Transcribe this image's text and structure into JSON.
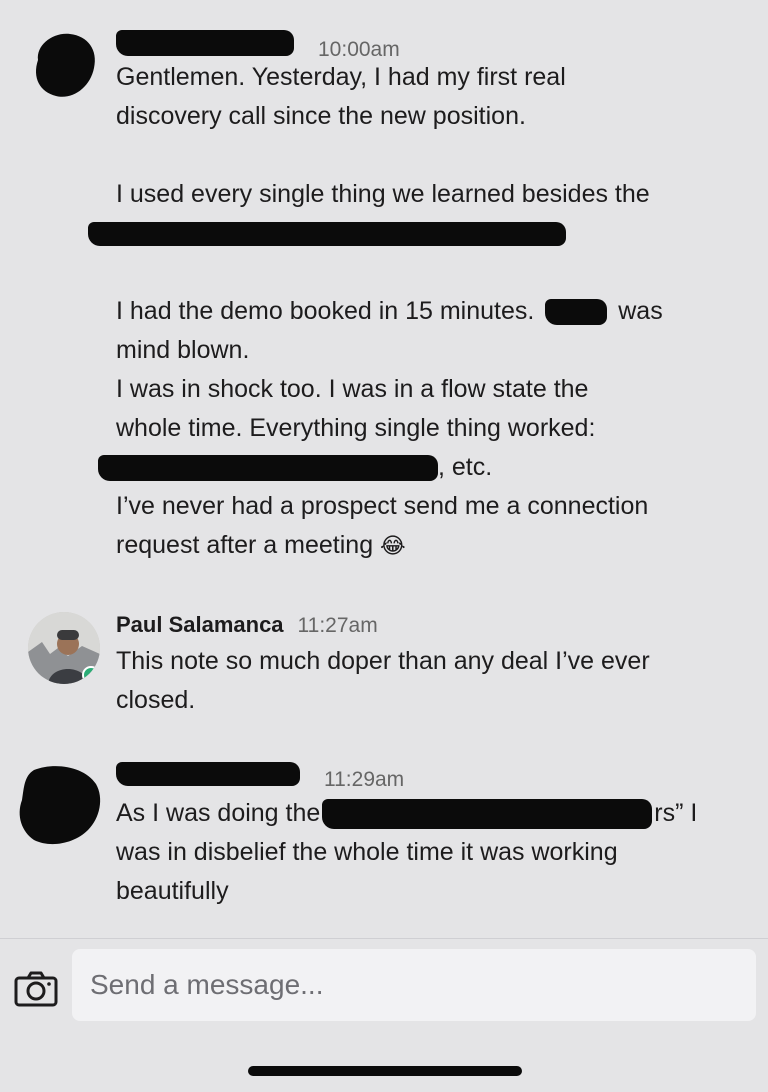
{
  "messages": [
    {
      "sender": "",
      "time": "10:00am",
      "lines": [
        "Gentlemen. Yesterday, I had my first real",
        "discovery call since the new position.",
        "",
        "I used every single thing we learned besides the",
        "[redacted]",
        "",
        "I had the demo booked in 15 minutes.",
        "was",
        "mind blown.",
        "I was in shock too. I was in a flow state the",
        "whole time. Everything single thing worked:",
        ", etc.",
        "I’ve never had a prospect send me a connection",
        "request after a meeting"
      ],
      "emoji": "😂"
    },
    {
      "sender": "Paul Salamanca",
      "time": "11:27am",
      "lines": [
        "This note so much doper than any deal I’ve ever",
        "closed."
      ],
      "status": "online"
    },
    {
      "sender": "",
      "time": "11:29am",
      "lines": [
        "As I was doing the",
        "rs” I",
        "was in disbelief the whole time it was working",
        "beautifully"
      ]
    }
  ],
  "composer": {
    "placeholder": "Send a message...",
    "camera_icon": "camera-icon"
  },
  "colors": {
    "background": "#e4e4e6",
    "online": "#2bac76",
    "redaction": "#0b0b0b"
  }
}
